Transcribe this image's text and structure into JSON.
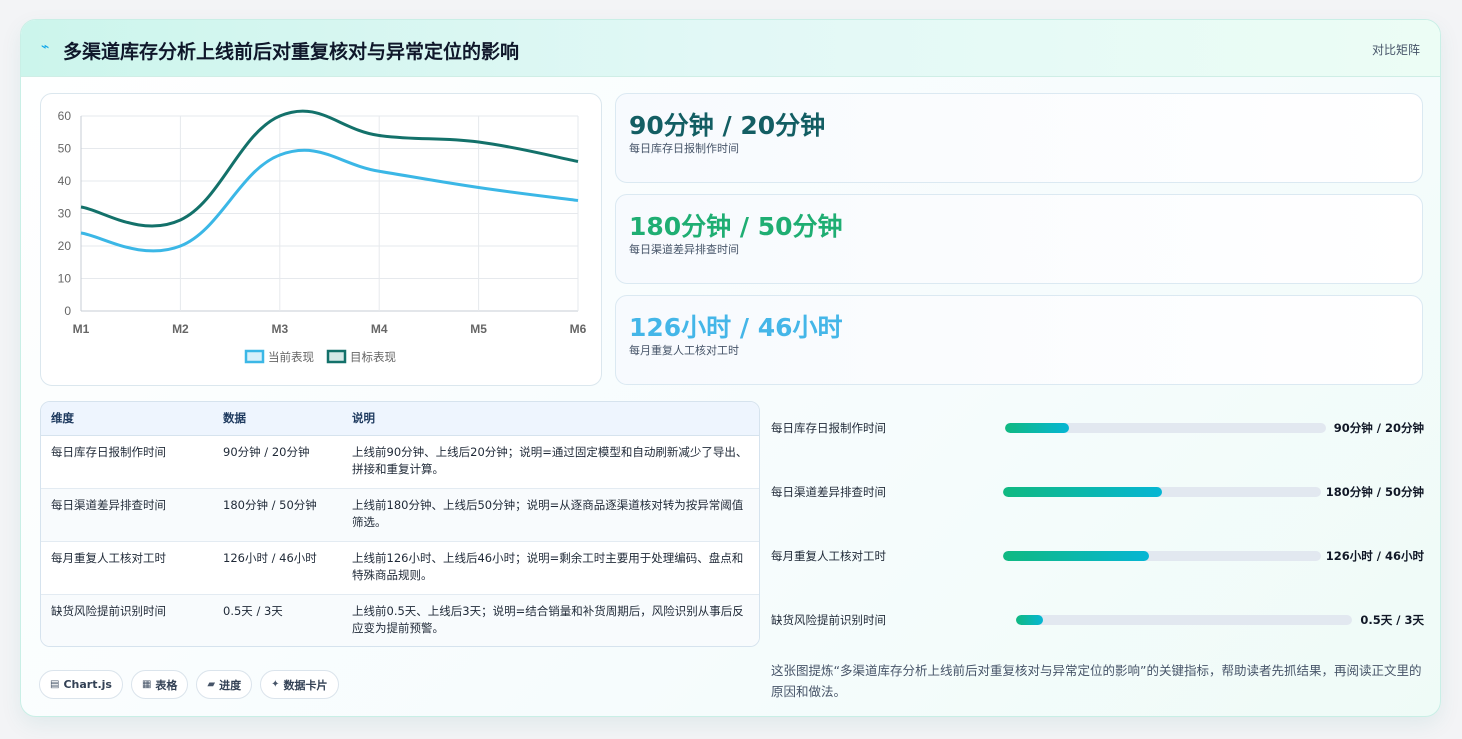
{
  "header": {
    "title": "多渠道库存分析上线前后对重复核对与异常定位的影响",
    "mode": "对比矩阵",
    "icon": "bolt-icon"
  },
  "chart_data": {
    "type": "line",
    "categories": [
      "M1",
      "M2",
      "M3",
      "M4",
      "M5",
      "M6"
    ],
    "series": [
      {
        "name": "当前表现",
        "values": [
          24,
          20,
          48,
          43,
          38,
          34
        ],
        "color": "#3bb7e6"
      },
      {
        "name": "目标表现",
        "values": [
          32,
          28,
          60,
          54,
          52,
          46
        ],
        "color": "#13716a"
      }
    ],
    "ylim": [
      0,
      60
    ],
    "yticks": [
      "0",
      "10",
      "20",
      "30",
      "40",
      "50",
      "60"
    ],
    "grid": true,
    "legend": "bottom",
    "title": "",
    "xlabel": "",
    "ylabel": ""
  },
  "metrics": [
    {
      "value": "90分钟 / 20分钟",
      "label": "每日库存日报制作时间",
      "color": "#135e63"
    },
    {
      "value": "180分钟 / 50分钟",
      "label": "每日渠道差异排查时间",
      "color": "#1fae73"
    },
    {
      "value": "126小时 / 46小时",
      "label": "每月重复人工核对工时",
      "color": "#44b6e8"
    }
  ],
  "table": {
    "headers": [
      "维度",
      "数据",
      "说明"
    ],
    "rows": [
      {
        "dim": "每日库存日报制作时间",
        "data": "90分钟 / 20分钟",
        "note": "上线前90分钟、上线后20分钟；说明=通过固定模型和自动刷新减少了导出、拼接和重复计算。"
      },
      {
        "dim": "每日渠道差异排查时间",
        "data": "180分钟 / 50分钟",
        "note": "上线前180分钟、上线后50分钟；说明=从逐商品逐渠道核对转为按异常阈值筛选。"
      },
      {
        "dim": "每月重复人工核对工时",
        "data": "126小时 / 46小时",
        "note": "上线前126小时、上线后46小时；说明=剩余工时主要用于处理编码、盘点和特殊商品规则。"
      },
      {
        "dim": "缺货风险提前识别时间",
        "data": "0.5天 / 3天",
        "note": "上线前0.5天、上线后3天；说明=结合销量和补货周期后，风险识别从事后反应变为提前预警。"
      }
    ]
  },
  "progress": [
    {
      "label": "每日库存日报制作时间",
      "value": "90分钟 / 20分钟",
      "fill": 0.2
    },
    {
      "label": "每日渠道差异排查时间",
      "value": "180分钟 / 50分钟",
      "fill": 0.5
    },
    {
      "label": "每月重复人工核对工时",
      "value": "126小时 / 46小时",
      "fill": 0.46
    },
    {
      "label": "缺货风险提前识别时间",
      "value": "0.5天 / 3天",
      "fill": 0.08
    }
  ],
  "summary": "这张图提炼“多渠道库存分析上线前后对重复核对与异常定位的影响”的关键指标，帮助读者先抓结果，再阅读正文里的原因和做法。",
  "tags": [
    {
      "icon": "▤",
      "label": "Chart.js",
      "icon_name": "chart-icon"
    },
    {
      "icon": "▦",
      "label": "表格",
      "icon_name": "table-icon"
    },
    {
      "icon": "▰",
      "label": "进度",
      "icon_name": "progress-icon"
    },
    {
      "icon": "✦",
      "label": "数据卡片",
      "icon_name": "sparkle-icon"
    }
  ]
}
